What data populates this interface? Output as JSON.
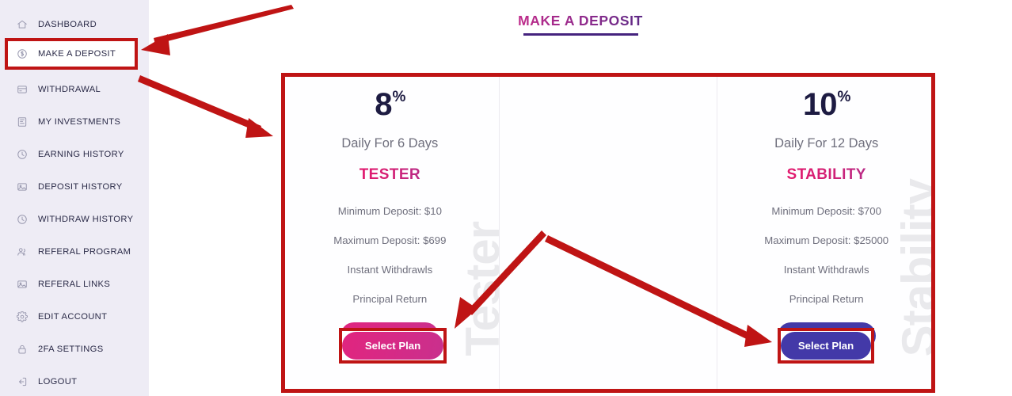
{
  "sidebar": {
    "items": [
      {
        "label": "DASHBOARD",
        "icon": "home-icon",
        "name": "sidebar-item-dashboard"
      },
      {
        "label": "MAKE A DEPOSIT",
        "icon": "dollar-circle-icon",
        "name": "sidebar-item-make-a-deposit"
      },
      {
        "label": "WITHDRAWAL",
        "icon": "card-icon",
        "name": "sidebar-item-withdrawal"
      },
      {
        "label": "MY INVESTMENTS",
        "icon": "book-icon",
        "name": "sidebar-item-my-investments"
      },
      {
        "label": "EARNING HISTORY",
        "icon": "clock-icon",
        "name": "sidebar-item-earning-history"
      },
      {
        "label": "DEPOSIT HISTORY",
        "icon": "image-icon",
        "name": "sidebar-item-deposit-history"
      },
      {
        "label": "WITHDRAW HISTORY",
        "icon": "clock-icon",
        "name": "sidebar-item-withdraw-history"
      },
      {
        "label": "REFERAL PROGRAM",
        "icon": "users-icon",
        "name": "sidebar-item-referal-program"
      },
      {
        "label": "REFERAL LINKS",
        "icon": "image-icon",
        "name": "sidebar-item-referal-links"
      },
      {
        "label": "EDIT ACCOUNT",
        "icon": "gear-icon",
        "name": "sidebar-item-edit-account"
      },
      {
        "label": "2FA SETTINGS",
        "icon": "lock-icon",
        "name": "sidebar-item-2fa-settings"
      },
      {
        "label": "LOGOUT",
        "icon": "logout-icon",
        "name": "sidebar-item-logout"
      }
    ]
  },
  "header": {
    "title": "MAKE A DEPOSIT"
  },
  "plans": [
    {
      "percent": "8",
      "percent_symbol": "%",
      "duration": "Daily For 6 Days",
      "name": "TESTER",
      "minimum": "Minimum Deposit: $10",
      "maximum": "Maximum Deposit: $699",
      "withdrawals": "Instant Withdrawls",
      "principal": "Principal Return",
      "button_label": "Select Plan",
      "watermark": "Tester",
      "button_style": "pink"
    },
    {
      "percent": "",
      "percent_symbol": "",
      "duration": "",
      "name": "",
      "minimum": "",
      "maximum": "",
      "withdrawals": "",
      "principal": "",
      "button_label": "",
      "watermark": "",
      "button_style": "none"
    },
    {
      "percent": "10",
      "percent_symbol": "%",
      "duration": "Daily For 12 Days",
      "name": "STABILITY",
      "minimum": "Minimum Deposit: $700",
      "maximum": "Maximum Deposit: $25000",
      "withdrawals": "Instant Withdrawls",
      "principal": "Principal Return",
      "button_label": "Select Plan",
      "watermark": "Stability",
      "button_style": "blue"
    }
  ],
  "annotations": {
    "highlight_color": "#bf1414",
    "sidebar_highlight_label": "MAKE A DEPOSIT",
    "button1_label": "Select Plan",
    "button2_label": "Select Plan"
  },
  "colors": {
    "sidebar_bg": "#eeecf5",
    "title_accent": "#45237e",
    "plan_name_accent": "#d41f74",
    "button_pink": "#d62a86",
    "button_blue": "#4339a8",
    "annotation_red": "#bf1414"
  }
}
